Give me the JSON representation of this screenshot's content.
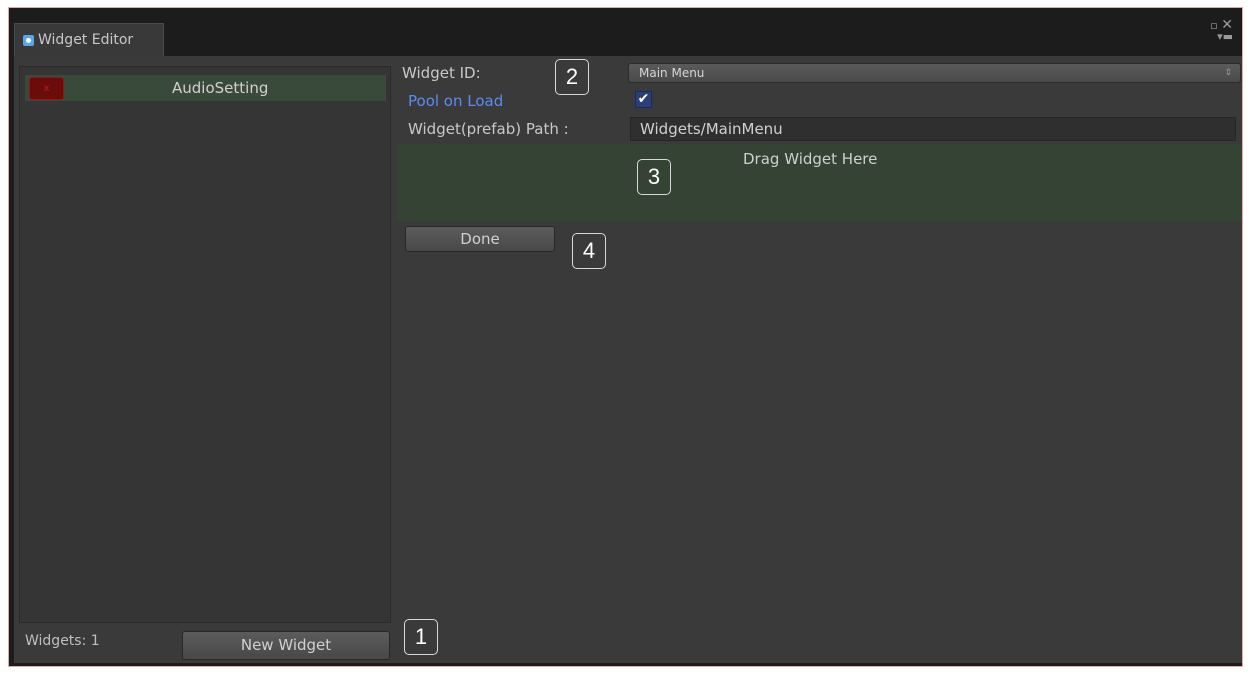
{
  "window": {
    "tab_title": "Widget Editor",
    "tab_icon": "gear-icon",
    "controls": {
      "maximize_icon": "maximize-icon",
      "close_icon": "close-icon",
      "menu_icon": "menu-icon"
    }
  },
  "widget_list": {
    "items": [
      {
        "label": "AudioSetting",
        "delete_label": "x"
      }
    ],
    "count_text": "Widgets: 1",
    "new_button_label": "New Widget"
  },
  "editor": {
    "widget_id_label": "Widget ID:",
    "widget_id_value": "Main Menu",
    "pool_label": "Pool on Load",
    "pool_checked": true,
    "pool_check_glyph": "✔",
    "path_label": "Widget(prefab) Path :",
    "path_value": "Widgets/MainMenu",
    "drop_zone_text": "Drag Widget Here",
    "done_label": "Done"
  },
  "callouts": [
    "1",
    "2",
    "3",
    "4"
  ],
  "colors": {
    "background": "#3a3a3a",
    "drop_zone": "#354335",
    "selected_item": "#3a4a3a",
    "delete_button": "#6a0c0c",
    "pool_label": "#5b8cf0",
    "checkbox": "#2a3f7a"
  }
}
